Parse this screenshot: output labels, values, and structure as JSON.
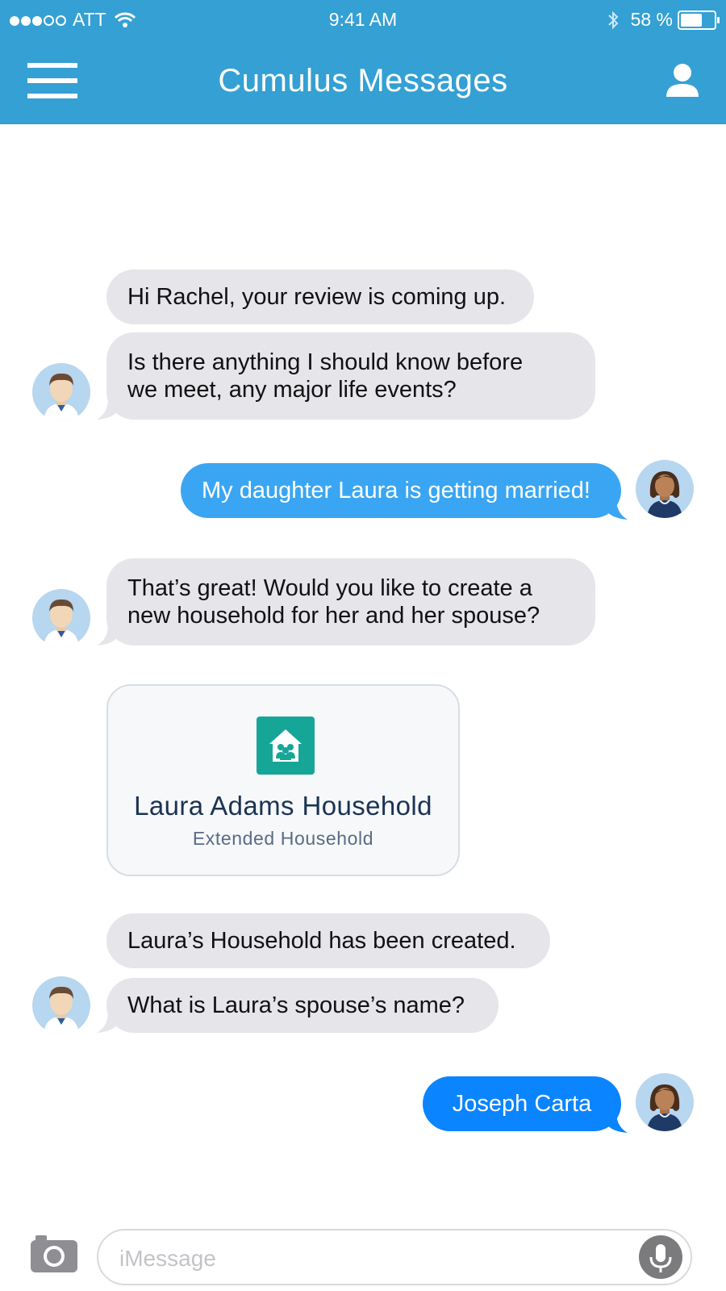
{
  "status_bar": {
    "carrier": "ATT",
    "time": "9:41 AM",
    "battery": "58 %",
    "battery_level": 0.58
  },
  "nav": {
    "title": "Cumulus Messages",
    "menu_icon": "hamburger-menu-icon",
    "profile_icon": "person-icon"
  },
  "messages": [
    {
      "side": "in",
      "text": "Hi Rachel, your review is coming up."
    },
    {
      "side": "in",
      "lines": [
        "Is there anything I should know before",
        "we meet, any major life events?"
      ]
    },
    {
      "side": "out",
      "text": "My daughter Laura is getting married!"
    },
    {
      "side": "in",
      "lines": [
        "That’s great! Would you like to create a",
        "new household for her and her spouse?"
      ]
    },
    {
      "side": "in",
      "text": "Laura’s Household has been created."
    },
    {
      "side": "in",
      "text": "What is Laura’s spouse’s name?"
    },
    {
      "side": "out",
      "text": "Joseph Carta"
    }
  ],
  "household_card": {
    "icon": "household-icon",
    "title": "Laura Adams Household",
    "subtitle": "Extended Household"
  },
  "composer": {
    "placeholder": "iMessage",
    "camera_icon": "camera-icon",
    "mic_icon": "microphone-icon"
  },
  "colors": {
    "header": "#34a0d3",
    "incoming_bubble": "#e5e5ea",
    "outgoing_bubble": "#3aa6f3",
    "outgoing_bubble_latest": "#0a84ff",
    "card_icon": "#16a698"
  }
}
